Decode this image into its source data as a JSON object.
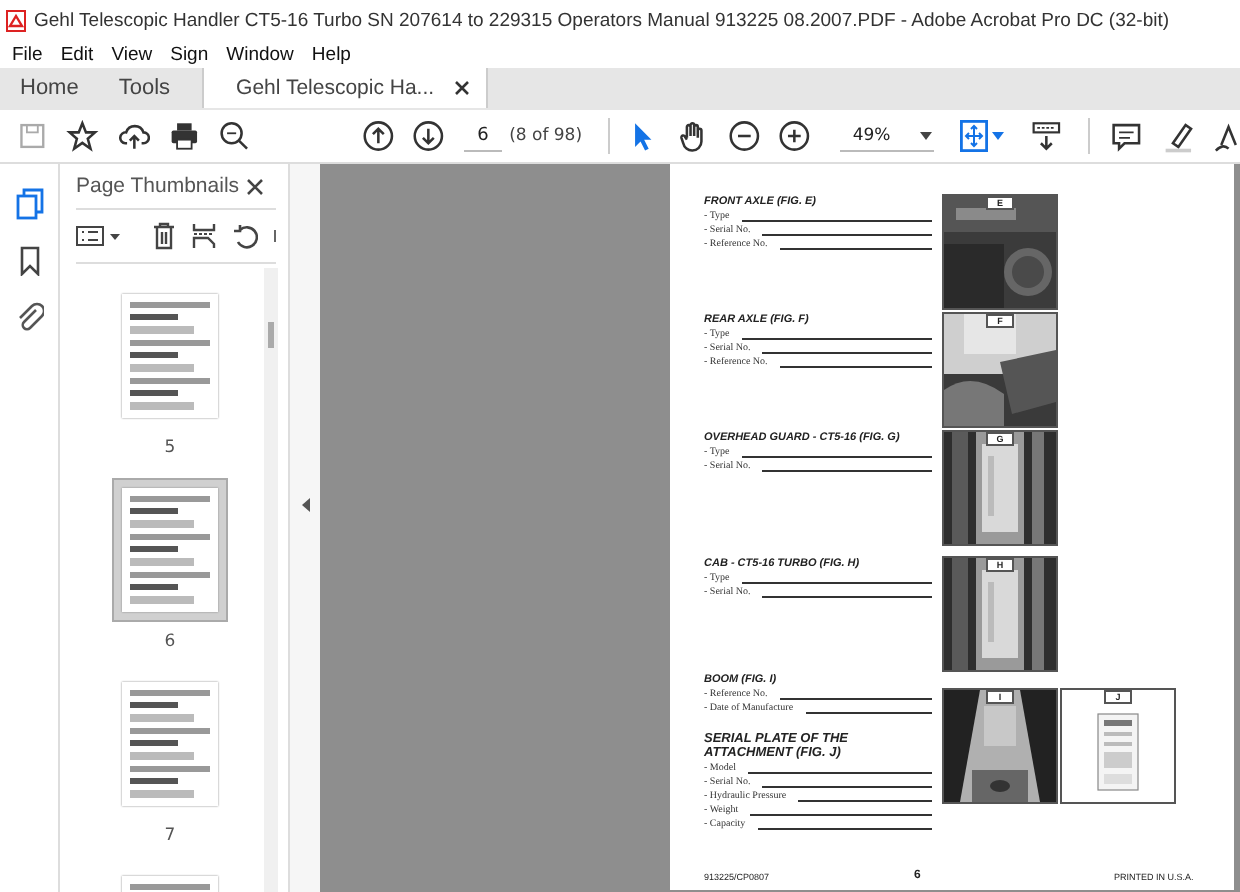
{
  "window": {
    "title": "Gehl Telescopic Handler CT5-16 Turbo SN 207614 to 229315 Operators Manual 913225 08.2007.PDF - Adobe Acrobat Pro DC (32-bit)"
  },
  "menu": [
    "File",
    "Edit",
    "View",
    "Sign",
    "Window",
    "Help"
  ],
  "tabs": [
    {
      "label": "Home",
      "selected": false,
      "closable": false
    },
    {
      "label": "Tools",
      "selected": false,
      "closable": false
    },
    {
      "label": "Gehl Telescopic Ha...",
      "selected": true,
      "closable": true
    }
  ],
  "toolbar": {
    "page_number": "6",
    "page_count": "(8 of 98)",
    "zoom": "49%"
  },
  "sidebar": {
    "title": "Page Thumbnails",
    "thumbnails": [
      {
        "label": "5",
        "selected": false
      },
      {
        "label": "6",
        "selected": true
      },
      {
        "label": "7",
        "selected": false
      },
      {
        "selected": false
      }
    ]
  },
  "document": {
    "rows": [
      {
        "sections": [
          {
            "heading": "FRONT AXLE (FIG. E)",
            "fields": [
              "- Type",
              "- Serial No.",
              "- Reference No."
            ]
          }
        ],
        "figures": [
          "E"
        ]
      },
      {
        "sections": [
          {
            "heading": "REAR AXLE (FIG. F)",
            "fields": [
              "- Type",
              "- Serial No.",
              "- Reference No."
            ]
          }
        ],
        "figures": [
          "F"
        ]
      },
      {
        "sections": [
          {
            "heading": "OVERHEAD GUARD - CT5-16 (FIG. G)",
            "fields": [
              "- Type",
              "- Serial No."
            ]
          }
        ],
        "figures": [
          "G"
        ]
      },
      {
        "sections": [
          {
            "heading": "CAB - CT5-16 TURBO (FIG. H)",
            "fields": [
              "- Type",
              "- Serial No."
            ]
          }
        ],
        "figures": [
          "H"
        ]
      },
      {
        "sections": [
          {
            "heading": "BOOM (FIG. I)",
            "fields": [
              "- Reference No.",
              "- Date of Manufacture"
            ]
          },
          {
            "heading": "SERIAL PLATE OF THE ATTACHMENT (FIG. J)",
            "fields": [
              "- Model",
              "- Serial No.",
              "- Hydraulic Pressure",
              "- Weight",
              "- Capacity"
            ]
          }
        ],
        "figures": [
          "I",
          "J"
        ]
      }
    ],
    "footer": {
      "code": "913225/CP0807",
      "page": "6",
      "printed": "PRINTED IN U.S.A."
    }
  }
}
